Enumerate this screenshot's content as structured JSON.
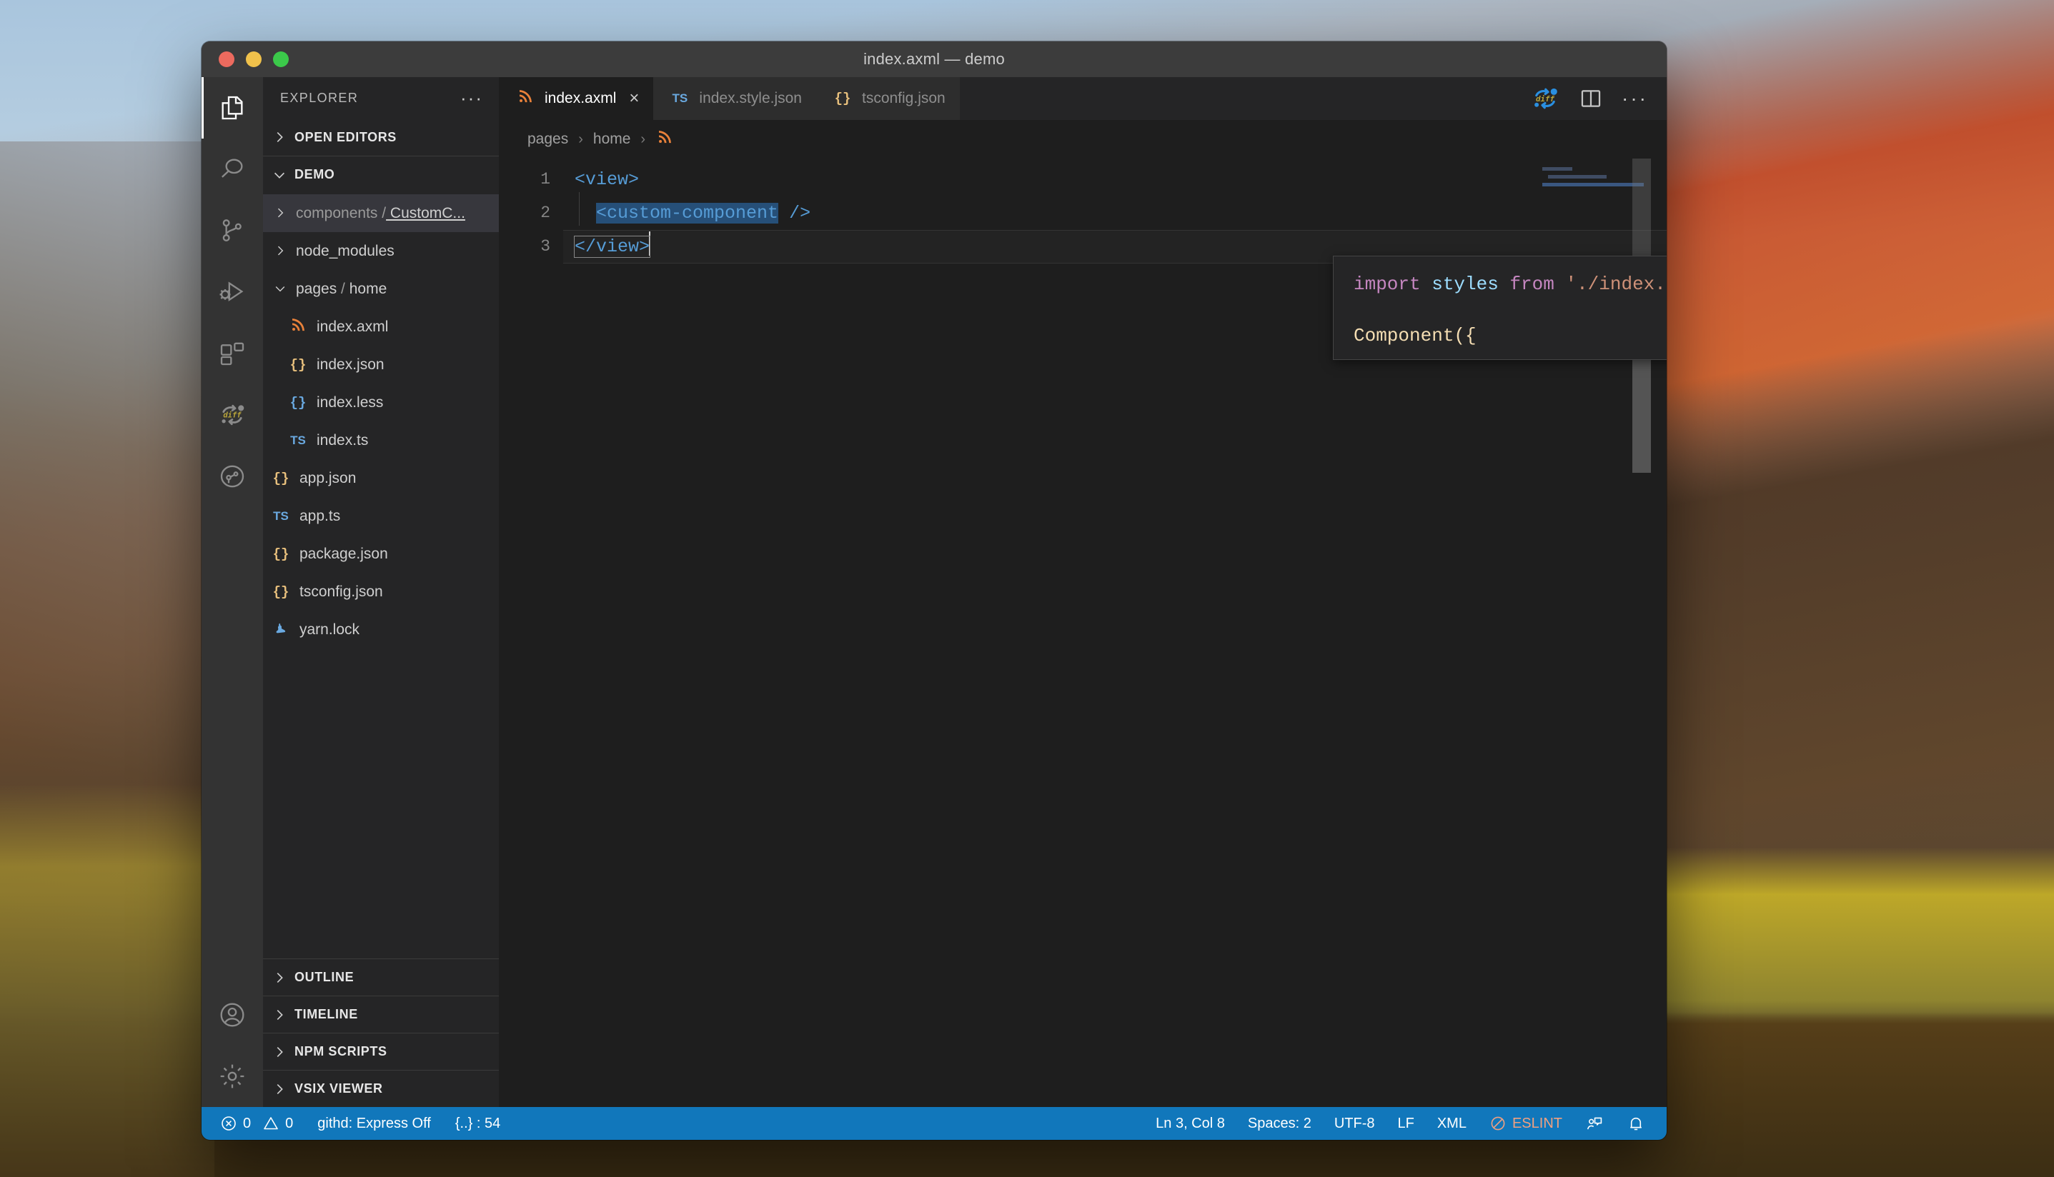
{
  "window": {
    "title": "index.axml — demo",
    "traffic_lights": [
      "close-red",
      "minimize-yellow",
      "zoom-green"
    ]
  },
  "activity_bar": {
    "items": [
      {
        "name": "explorer",
        "icon": "files-icon",
        "active": true
      },
      {
        "name": "search",
        "icon": "search-icon",
        "active": false
      },
      {
        "name": "source-control",
        "icon": "source-control-icon",
        "active": false
      },
      {
        "name": "run-and-debug",
        "icon": "run-debug-icon",
        "active": false
      },
      {
        "name": "extensions",
        "icon": "extensions-icon",
        "active": false
      },
      {
        "name": "diff",
        "icon": "diff-icon",
        "active": false
      },
      {
        "name": "git-history",
        "icon": "git-history-icon",
        "active": false
      }
    ],
    "bottom_items": [
      {
        "name": "accounts",
        "icon": "account-icon"
      },
      {
        "name": "manage",
        "icon": "gear-icon"
      }
    ]
  },
  "sidebar": {
    "title": "EXPLORER",
    "more_actions": "···",
    "sections": {
      "open_editors": "OPEN EDITORS",
      "workspace": "DEMO",
      "outline": "OUTLINE",
      "timeline": "TIMELINE",
      "npm_scripts": "NPM SCRIPTS",
      "vsix_viewer": "VSIX VIEWER"
    },
    "tree": [
      {
        "label": "components / CustomC...",
        "icon": "folder",
        "kind": "folder",
        "expanded": false,
        "depth": 1,
        "selected": true,
        "dim_part": "components /",
        "link_part": " CustomC..."
      },
      {
        "label": "node_modules",
        "icon": "folder",
        "kind": "folder",
        "expanded": false,
        "depth": 1,
        "selected": false
      },
      {
        "label": "pages / home",
        "icon": "folder",
        "kind": "folder",
        "expanded": true,
        "depth": 1,
        "selected": false,
        "dim_part": "pages /",
        "link_part": " home"
      },
      {
        "label": "index.axml",
        "icon": "axml",
        "kind": "file",
        "depth": 2,
        "selected": false
      },
      {
        "label": "index.json",
        "icon": "json",
        "kind": "file",
        "depth": 2,
        "selected": false
      },
      {
        "label": "index.less",
        "icon": "less",
        "kind": "file",
        "depth": 2,
        "selected": false
      },
      {
        "label": "index.ts",
        "icon": "ts",
        "kind": "file",
        "depth": 2,
        "selected": false
      },
      {
        "label": "app.json",
        "icon": "json",
        "kind": "file",
        "depth": 1,
        "selected": false
      },
      {
        "label": "app.ts",
        "icon": "ts",
        "kind": "file",
        "depth": 1,
        "selected": false
      },
      {
        "label": "package.json",
        "icon": "json",
        "kind": "file",
        "depth": 1,
        "selected": false
      },
      {
        "label": "tsconfig.json",
        "icon": "json",
        "kind": "file",
        "depth": 1,
        "selected": false
      },
      {
        "label": "yarn.lock",
        "icon": "lock",
        "kind": "file",
        "depth": 1,
        "selected": false
      }
    ]
  },
  "editor": {
    "tabs": [
      {
        "label": "index.axml",
        "icon": "axml",
        "active": true,
        "close": "×"
      },
      {
        "label": "index.style.json",
        "icon": "ts",
        "active": false
      },
      {
        "label": "tsconfig.json",
        "icon": "json",
        "active": false
      }
    ],
    "tab_actions": [
      {
        "name": "diff-toggle",
        "icon": "diff-icon"
      },
      {
        "name": "split-editor",
        "icon": "split-editor-icon"
      },
      {
        "name": "more-actions",
        "icon": "ellipsis-icon",
        "label": "···"
      }
    ],
    "breadcrumb": [
      "pages",
      "home"
    ],
    "breadcrumb_separator": "›",
    "line_numbers": [
      "1",
      "2",
      "3"
    ],
    "code": {
      "line1": "<view>",
      "line2_indent": "  ",
      "line2_tag": "<custom-component",
      "line2_rest": " />",
      "line3": "</view>"
    }
  },
  "overlay": {
    "line1_import": "import",
    "line1_styles": " styles",
    "line1_from": " from",
    "line1_path": " './index.style.json'",
    "line1_semi": ";",
    "line2": "Component({"
  },
  "status_bar": {
    "errors": "0",
    "warnings": "0",
    "githd": "githd: Express Off",
    "brackets": "{..} : 54",
    "cursor_position": "Ln 3, Col 8",
    "indentation": "Spaces: 2",
    "encoding": "UTF-8",
    "eol": "LF",
    "language": "XML",
    "eslint": "ESLINT",
    "feedback_icon": "feedback-icon",
    "notifications_icon": "bell-icon",
    "accent_color": "#1177bb"
  }
}
